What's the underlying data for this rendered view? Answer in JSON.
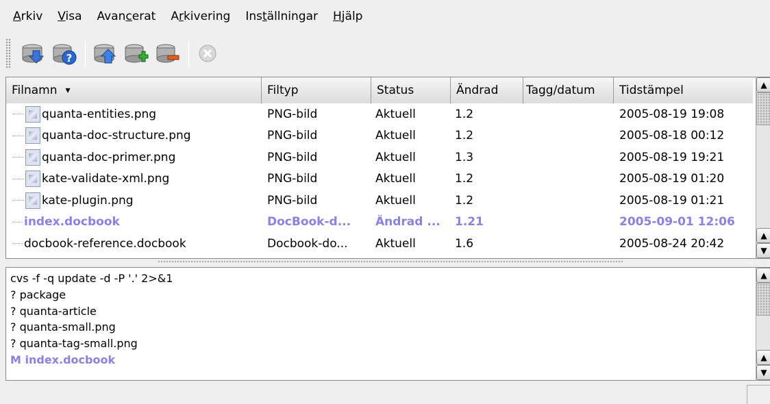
{
  "menubar": {
    "items": [
      {
        "pre": "",
        "ul": "A",
        "post": "rkiv"
      },
      {
        "pre": "",
        "ul": "V",
        "post": "isa"
      },
      {
        "pre": "Avan",
        "ul": "c",
        "post": "erat"
      },
      {
        "pre": "A",
        "ul": "r",
        "post": "kivering"
      },
      {
        "pre": "Ins",
        "ul": "t",
        "post": "ällningar"
      },
      {
        "pre": "",
        "ul": "H",
        "post": "jälp"
      }
    ]
  },
  "toolbar": {
    "icons": [
      "db-download-icon",
      "db-help-icon",
      "db-upload-icon",
      "db-add-icon",
      "db-remove-icon",
      "stop-icon"
    ]
  },
  "filelist": {
    "columns": [
      "Filnamn",
      "Filtyp",
      "Status",
      "Ändrad",
      "Tagg/datum",
      "Tidstämpel"
    ],
    "sort_indicator": "▾",
    "rows": [
      {
        "name": "quanta-entities.png",
        "type": "PNG-bild",
        "status": "Aktuell",
        "rev": "1.2",
        "tag": "",
        "time": "2005-08-19 19:08",
        "icon": true,
        "mod": false
      },
      {
        "name": "quanta-doc-structure.png",
        "type": "PNG-bild",
        "status": "Aktuell",
        "rev": "1.2",
        "tag": "",
        "time": "2005-08-18 00:12",
        "icon": true,
        "mod": false
      },
      {
        "name": "quanta-doc-primer.png",
        "type": "PNG-bild",
        "status": "Aktuell",
        "rev": "1.3",
        "tag": "",
        "time": "2005-08-19 19:21",
        "icon": true,
        "mod": false
      },
      {
        "name": "kate-validate-xml.png",
        "type": "PNG-bild",
        "status": "Aktuell",
        "rev": "1.2",
        "tag": "",
        "time": "2005-08-19 01:20",
        "icon": true,
        "mod": false
      },
      {
        "name": "kate-plugin.png",
        "type": "PNG-bild",
        "status": "Aktuell",
        "rev": "1.2",
        "tag": "",
        "time": "2005-08-19 01:21",
        "icon": true,
        "mod": false
      },
      {
        "name": "index.docbook",
        "type": "DocBook-d...",
        "status": "Ändrad ...",
        "rev": "1.21",
        "tag": "",
        "time": "2005-09-01 12:06",
        "icon": false,
        "mod": true
      },
      {
        "name": "docbook-reference.docbook",
        "type": "Docbook-do...",
        "status": "Aktuell",
        "rev": "1.6",
        "tag": "",
        "time": "2005-08-24 20:42",
        "icon": false,
        "mod": false
      }
    ]
  },
  "log": {
    "lines": [
      {
        "text": "cvs -f -q update -d -P  '.' 2>&1",
        "mod": false
      },
      {
        "text": "? package",
        "mod": false
      },
      {
        "text": "? quanta-article",
        "mod": false
      },
      {
        "text": "? quanta-small.png",
        "mod": false
      },
      {
        "text": "? quanta-tag-small.png",
        "mod": false
      },
      {
        "text": "M index.docbook",
        "mod": true
      }
    ]
  }
}
